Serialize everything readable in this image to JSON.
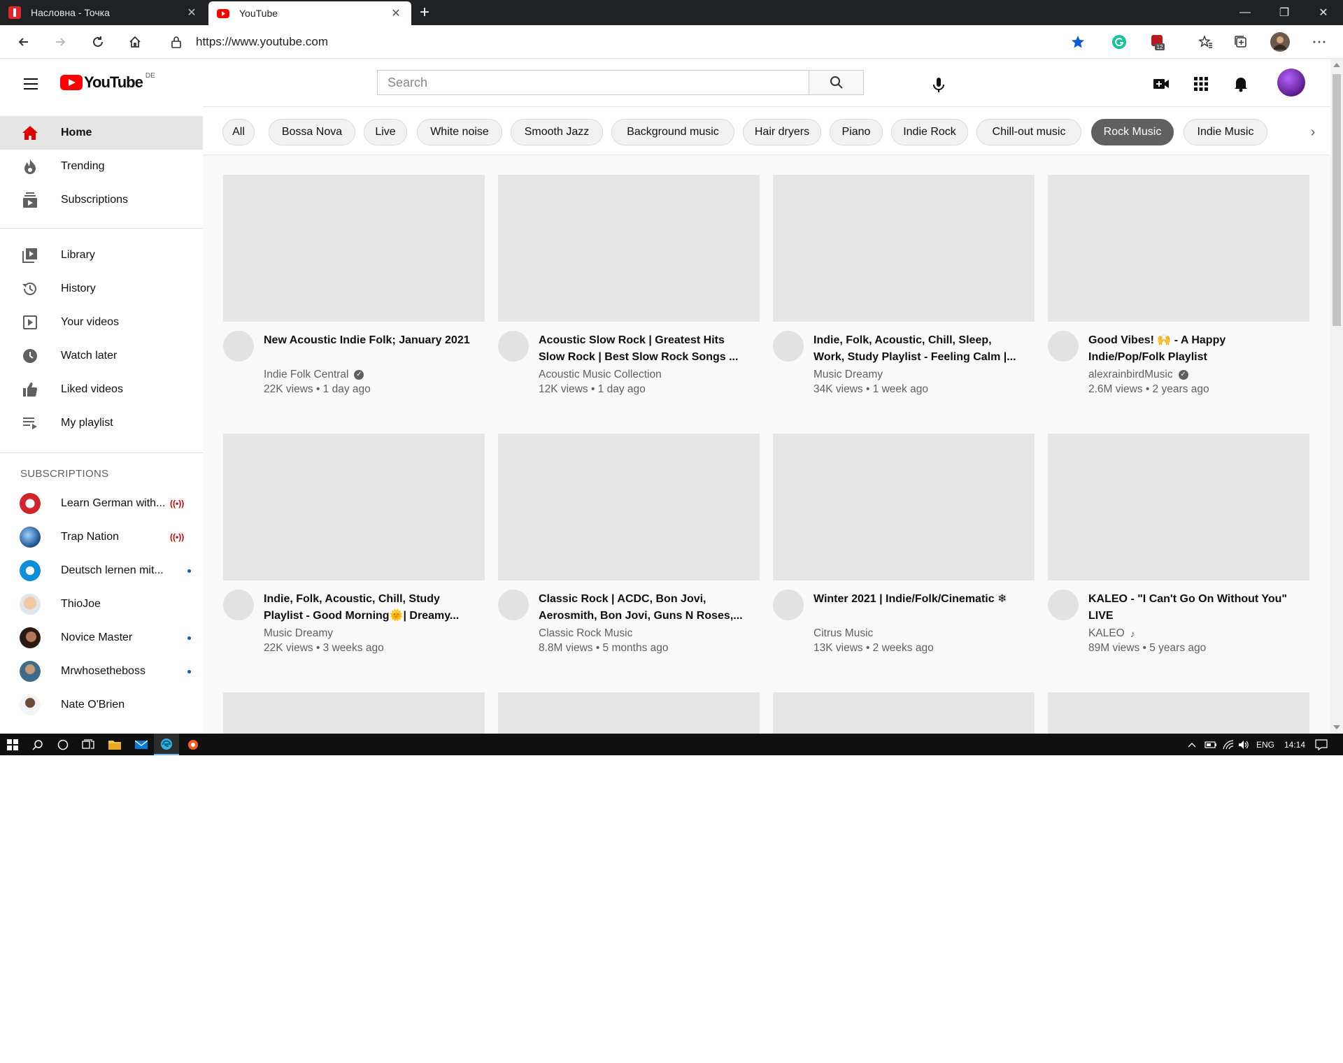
{
  "browser": {
    "tabs": [
      {
        "title": "Насловна - Точка",
        "icon": "tocka-favicon"
      },
      {
        "title": "YouTube",
        "icon": "youtube-favicon"
      }
    ],
    "url": "https://www.youtube.com",
    "extension_badge": "12"
  },
  "masthead": {
    "logo_text": "YouTube",
    "region": "DE",
    "search_placeholder": "Search"
  },
  "sidebar": {
    "primary": [
      {
        "label": "Home",
        "icon": "home-icon"
      },
      {
        "label": "Trending",
        "icon": "trending-icon"
      },
      {
        "label": "Subscriptions",
        "icon": "subscriptions-icon"
      }
    ],
    "library": [
      {
        "label": "Library",
        "icon": "library-icon"
      },
      {
        "label": "History",
        "icon": "history-icon"
      },
      {
        "label": "Your videos",
        "icon": "your-videos-icon"
      },
      {
        "label": "Watch later",
        "icon": "watch-later-icon"
      },
      {
        "label": "Liked videos",
        "icon": "liked-videos-icon"
      },
      {
        "label": "My playlist",
        "icon": "playlist-icon"
      }
    ],
    "subscriptions_heading": "SUBSCRIPTIONS",
    "subscriptions": [
      {
        "name": "Learn German with...",
        "status": "live"
      },
      {
        "name": "Trap Nation",
        "status": "live"
      },
      {
        "name": "Deutsch lernen mit...",
        "status": "new"
      },
      {
        "name": "ThioJoe",
        "status": ""
      },
      {
        "name": "Novice Master",
        "status": "new"
      },
      {
        "name": "Mrwhosetheboss",
        "status": "new"
      },
      {
        "name": "Nate O'Brien",
        "status": ""
      }
    ]
  },
  "chips": [
    "All",
    "Bossa Nova",
    "Live",
    "White noise",
    "Smooth Jazz",
    "Background music",
    "Hair dryers",
    "Piano",
    "Indie Rock",
    "Chill-out music",
    "Rock Music",
    "Indie Music"
  ],
  "active_chip": "Rock Music",
  "videos": [
    {
      "title": "New Acoustic Indie Folk; January 2021",
      "channel": "Indie Folk Central",
      "badge": "verified",
      "stats": "22K views • 1 day ago"
    },
    {
      "title": "Acoustic Slow Rock | Greatest Hits Slow Rock | Best Slow Rock Songs ...",
      "channel": "Acoustic Music Collection",
      "badge": "",
      "stats": "12K views • 1 day ago"
    },
    {
      "title": "Indie, Folk, Acoustic, Chill, Sleep, Work, Study Playlist - Feeling Calm |...",
      "channel": "Music Dreamy",
      "badge": "",
      "stats": "34K views • 1 week ago"
    },
    {
      "title": "Good Vibes! 🙌 - A Happy Indie/Pop/Folk Playlist",
      "channel": "alexrainbirdMusic",
      "badge": "verified",
      "stats": "2.6M views • 2 years ago"
    },
    {
      "title": "Indie, Folk, Acoustic, Chill, Study Playlist - Good Morning🌞| Dreamy...",
      "channel": "Music Dreamy",
      "badge": "",
      "stats": "22K views • 3 weeks ago"
    },
    {
      "title": "Classic Rock | ACDC, Bon Jovi, Aerosmith, Bon Jovi, Guns N Roses,...",
      "channel": "Classic Rock Music",
      "badge": "",
      "stats": "8.8M views • 5 months ago"
    },
    {
      "title": "Winter 2021 | Indie/Folk/Cinematic ❄",
      "channel": "Citrus Music",
      "badge": "",
      "stats": "13K views • 2 weeks ago"
    },
    {
      "title": "KALEO - \"I Can't Go On Without You\" LIVE",
      "channel": "KALEO",
      "badge": "music-note",
      "stats": "89M views • 5 years ago"
    }
  ],
  "taskbar": {
    "language": "ENG",
    "time": "14:14"
  }
}
